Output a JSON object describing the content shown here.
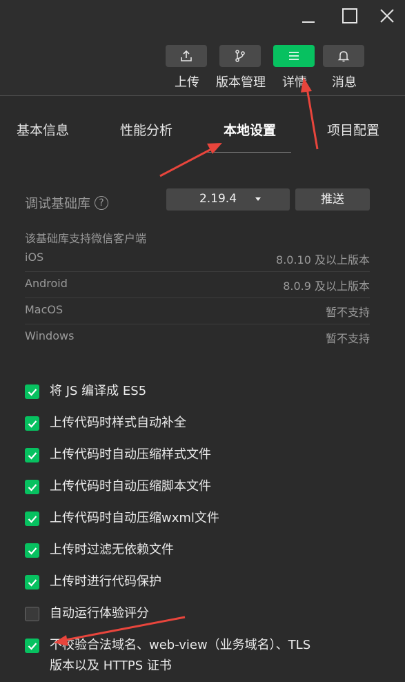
{
  "toolbar": {
    "upload_label": "上传",
    "version_label": "版本管理",
    "details_label": "详情",
    "messages_label": "消息"
  },
  "tabs": {
    "basic": "基本信息",
    "performance": "性能分析",
    "local": "本地设置",
    "project": "项目配置"
  },
  "sdk": {
    "label": "调试基础库",
    "help": "?",
    "version": "2.19.4",
    "push_label": "推送",
    "support_note": "该基础库支持微信客户端",
    "platforms": [
      {
        "name": "iOS",
        "version": "8.0.10 及以上版本"
      },
      {
        "name": "Android",
        "version": "8.0.9 及以上版本"
      },
      {
        "name": "MacOS",
        "version": "暂不支持"
      },
      {
        "name": "Windows",
        "version": "暂不支持"
      }
    ]
  },
  "options": [
    {
      "label": "将 JS 编译成 ES5",
      "checked": true
    },
    {
      "label": "上传代码时样式自动补全",
      "checked": true
    },
    {
      "label": "上传代码时自动压缩样式文件",
      "checked": true
    },
    {
      "label": "上传代码时自动压缩脚本文件",
      "checked": true
    },
    {
      "label": "上传代码时自动压缩wxml文件",
      "checked": true
    },
    {
      "label": "上传时过滤无依赖文件",
      "checked": true
    },
    {
      "label": "上传时进行代码保护",
      "checked": true
    },
    {
      "label": "自动运行体验评分",
      "checked": false
    },
    {
      "label": "不校验合法域名、web-view（业务域名）、TLS",
      "label2": "版本以及 HTTPS 证书",
      "checked": true
    }
  ],
  "colors": {
    "accent": "#07c160",
    "annotation_arrow": "#e8453c"
  }
}
